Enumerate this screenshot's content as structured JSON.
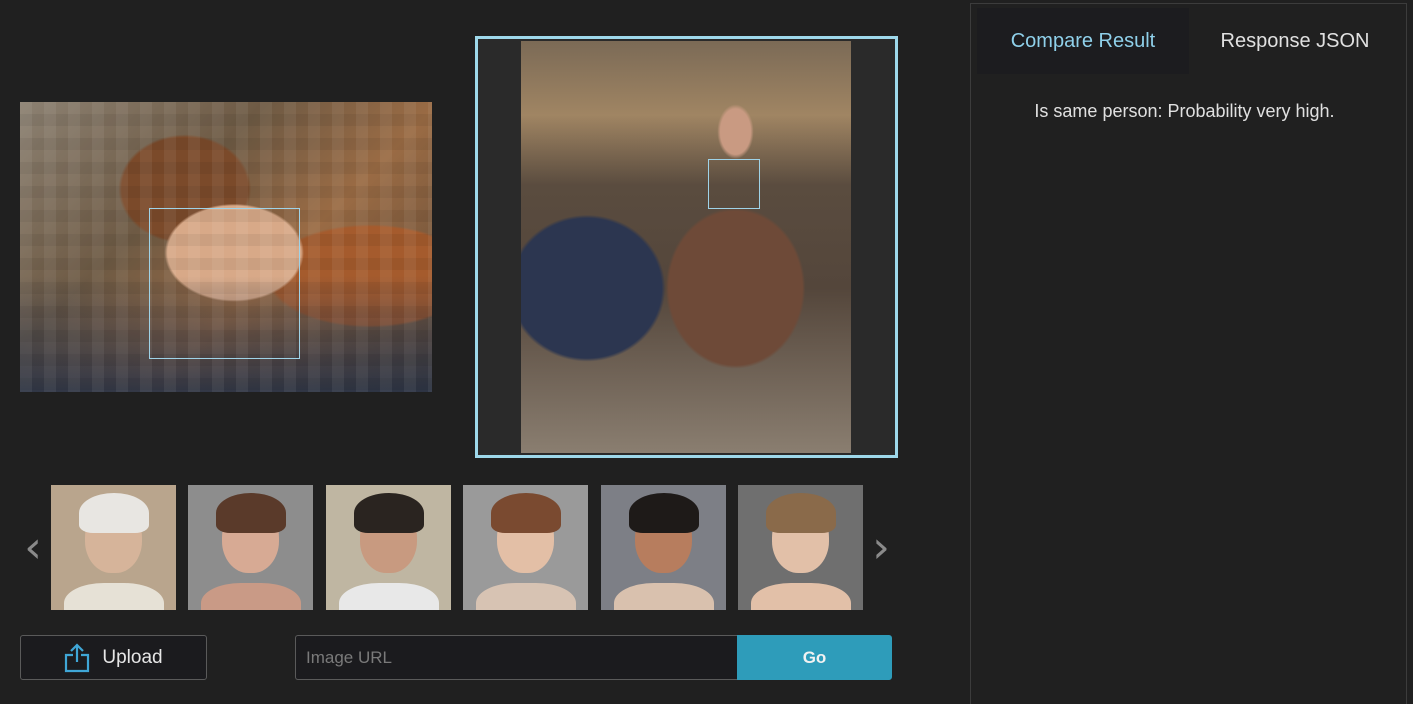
{
  "gallery": {
    "prev_arrow": "‹",
    "next_arrow": "›",
    "thumbnails": [
      {
        "icon": "elderly-man-portrait",
        "bg": "#b9a58d",
        "skin": "#d6b49a",
        "hair": "#e8e6e2",
        "cloth": "#e6e1d6"
      },
      {
        "icon": "woman-portrait",
        "bg": "#8d8d8d",
        "skin": "#d7aa94",
        "hair": "#5a3a2a",
        "cloth": "#c99a86"
      },
      {
        "icon": "man-glasses-portrait",
        "bg": "#bfb6a2",
        "skin": "#c89a80",
        "hair": "#2a2420",
        "cloth": "#e8e8e8"
      },
      {
        "icon": "girl-portrait",
        "bg": "#9a9a9a",
        "skin": "#e3bfa6",
        "hair": "#7a4a30",
        "cloth": "#d7c3b3"
      },
      {
        "icon": "smiling-woman-portrait",
        "bg": "#7d7f86",
        "skin": "#b77d5e",
        "hair": "#1e1a18",
        "cloth": "#d9c1ae"
      },
      {
        "icon": "blonde-woman-portrait",
        "bg": "#6f6f6f",
        "skin": "#e2c0a8",
        "hair": "#8a6a4a",
        "cloth": "#e2c0a8"
      }
    ]
  },
  "controls": {
    "upload_label": "Upload",
    "url_placeholder": "Image URL",
    "go_label": "Go"
  },
  "panel": {
    "tabs": [
      "Compare Result",
      "Response JSON"
    ],
    "active_tab": "Compare Result",
    "result_text": "Is same person: Probability very high."
  },
  "colors": {
    "accent": "#8fd0ea",
    "go_button": "#2e9cba",
    "background": "#202020"
  }
}
